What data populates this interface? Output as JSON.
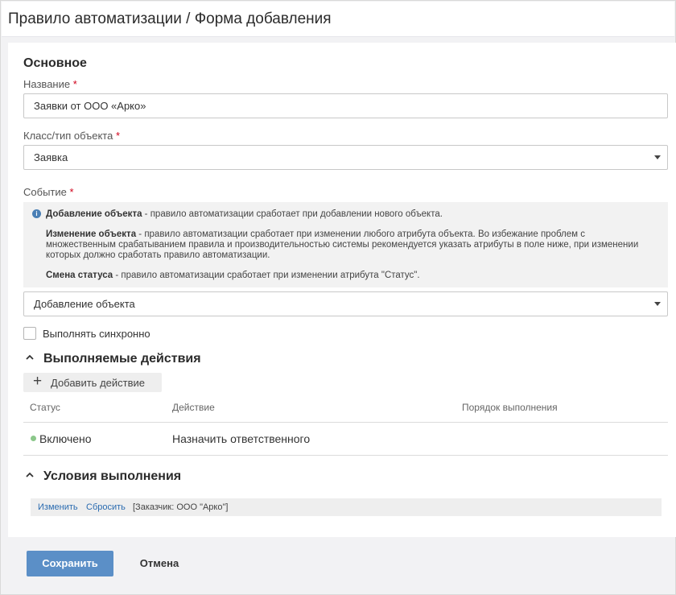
{
  "header": {
    "title": "Правило автоматизации / Форма добавления"
  },
  "form": {
    "section_title": "Основное",
    "name": {
      "label": "Название",
      "required_mark": "*",
      "value": "Заявки от ООО «Арко»"
    },
    "class": {
      "label": "Класс/тип объекта",
      "required_mark": "*",
      "value": "Заявка"
    },
    "event": {
      "label": "Событие",
      "required_mark": "*",
      "info": [
        {
          "term": "Добавление объекта",
          "text": " - правило автоматизации сработает при добавлении нового объекта."
        },
        {
          "term": "Изменение объекта",
          "text": " - правило автоматизации сработает при изменении любого атрибута объекта. Во избежание проблем с множественным срабатыванием правила и производительностью системы рекомендуется указать атрибуты в поле ниже, при изменении которых должно сработать правило автоматизации."
        },
        {
          "term": "Смена статуса",
          "text": " - правило автоматизации сработает при изменении атрибута \"Статус\"."
        }
      ],
      "value": "Добавление объекта"
    },
    "sync": {
      "label": "Выполнять синхронно",
      "checked": false
    }
  },
  "actions": {
    "title": "Выполняемые действия",
    "add_label": "Добавить действие",
    "columns": [
      "Статус",
      "Действие",
      "Порядок выполнения"
    ],
    "rows": [
      {
        "status": "Включено",
        "status_color": "#8bc78a",
        "action": "Назначить ответственного",
        "order": ""
      }
    ]
  },
  "conditions": {
    "title": "Условия выполнения",
    "edit_label": "Изменить",
    "reset_label": "Сбросить",
    "value": "[Заказчик: ООО \"Арко\"]"
  },
  "footer": {
    "save_label": "Сохранить",
    "cancel_label": "Отмена"
  },
  "colors": {
    "accent": "#5b8fc7",
    "link": "#2a6bb0",
    "required": "#d0021b"
  }
}
